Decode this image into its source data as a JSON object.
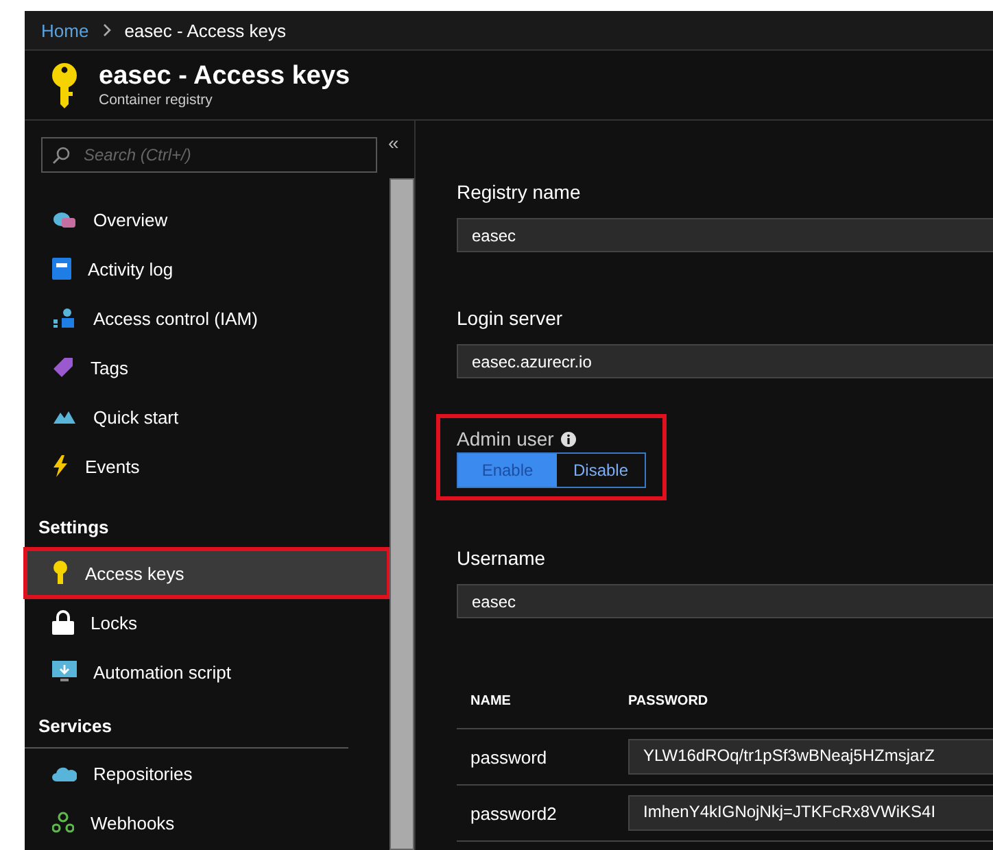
{
  "breadcrumb": [
    {
      "label": "Home",
      "link": true
    },
    {
      "label": "easec - Access keys",
      "link": false
    }
  ],
  "header": {
    "title": "easec - Access keys",
    "subtitle": "Container registry"
  },
  "sidebar": {
    "search": {
      "placeholder": "Search (Ctrl+/)"
    },
    "collapse": "«",
    "sections": [
      {
        "items": [
          {
            "label": "Overview",
            "selected": false,
            "highlighted": false
          },
          {
            "label": "Activity log",
            "selected": false,
            "highlighted": false
          },
          {
            "label": "Access control (IAM)",
            "selected": false,
            "highlighted": false
          },
          {
            "label": "Tags",
            "selected": false,
            "highlighted": false
          },
          {
            "label": "Quick start",
            "selected": false,
            "highlighted": false
          },
          {
            "label": "Events",
            "selected": false,
            "highlighted": false
          }
        ]
      },
      {
        "heading": "Settings",
        "items": [
          {
            "label": "Access keys",
            "selected": true,
            "highlighted": true
          },
          {
            "label": "Locks",
            "selected": false,
            "highlighted": false
          },
          {
            "label": "Automation script",
            "selected": false,
            "highlighted": false
          }
        ]
      },
      {
        "heading": "Services",
        "items": [
          {
            "label": "Repositories",
            "selected": false,
            "highlighted": false
          },
          {
            "label": "Webhooks",
            "selected": false,
            "highlighted": false
          }
        ]
      }
    ]
  },
  "content": {
    "registry_name": {
      "label": "Registry name",
      "value": "easec"
    },
    "login_server": {
      "label": "Login server",
      "value": "easec.azurecr.io"
    },
    "admin_user": {
      "label": "Admin user",
      "highlighted": true,
      "options": [
        {
          "label": "Enable",
          "selected": true
        },
        {
          "label": "Disable",
          "selected": false
        }
      ]
    },
    "username": {
      "label": "Username",
      "value": "easec"
    },
    "passwords": {
      "columns": [
        "NAME",
        "PASSWORD"
      ],
      "rows": [
        {
          "name": "password",
          "value": "YLW16dROq/tr1pSf3wBNeaj5HZmsjarZ"
        },
        {
          "name": "password2",
          "value": "ImhenY4kIGNojNkj=JTKFcRx8VWiKS4I"
        }
      ]
    }
  }
}
